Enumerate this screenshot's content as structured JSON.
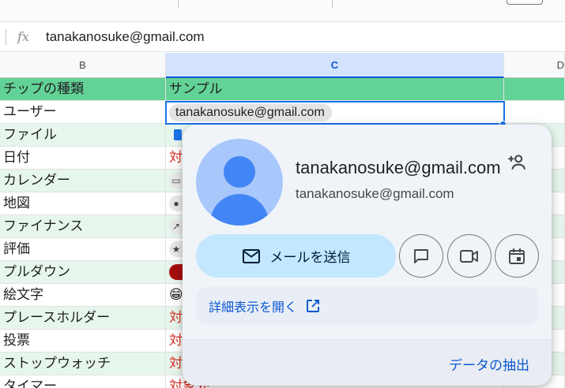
{
  "formula_bar": {
    "fx_label": "fx",
    "value": "tanakanosuke@gmail.com"
  },
  "columns": [
    {
      "label": "B"
    },
    {
      "label": "C"
    },
    {
      "label": "D"
    }
  ],
  "rows": [
    {
      "b": "チップの種類",
      "c": "サンプル"
    },
    {
      "b": "ユーザー",
      "c_chip": "tanakanosuke@gmail.com"
    },
    {
      "b": "ファイル",
      "c": ""
    },
    {
      "b": "日付",
      "c": "対"
    },
    {
      "b": "カレンダー",
      "c": ""
    },
    {
      "b": "地図",
      "c": ""
    },
    {
      "b": "ファイナンス",
      "c": ""
    },
    {
      "b": "評価",
      "c": "★"
    },
    {
      "b": "プルダウン",
      "c": ""
    },
    {
      "b": "絵文字",
      "c": "😁"
    },
    {
      "b": "プレースホルダー",
      "c": "対"
    },
    {
      "b": "投票",
      "c": "対"
    },
    {
      "b": "ストップウォッチ",
      "c": "対"
    },
    {
      "b": "タイマー",
      "c": "対象外"
    }
  ],
  "popup": {
    "name": "tanakanosuke@gmail.com",
    "email": "tanakanosuke@gmail.com",
    "send_mail_label": "メールを送信",
    "open_details_label": "詳細表示を開く",
    "extract_data_label": "データの抽出"
  },
  "colors": {
    "header_row": "#63d297",
    "banded_row": "#e7f6ed",
    "selection": "#1a73e8",
    "card_bg": "#f0f4f9",
    "mail_button": "#c2e7ff",
    "link_blue": "#0b57d0"
  }
}
